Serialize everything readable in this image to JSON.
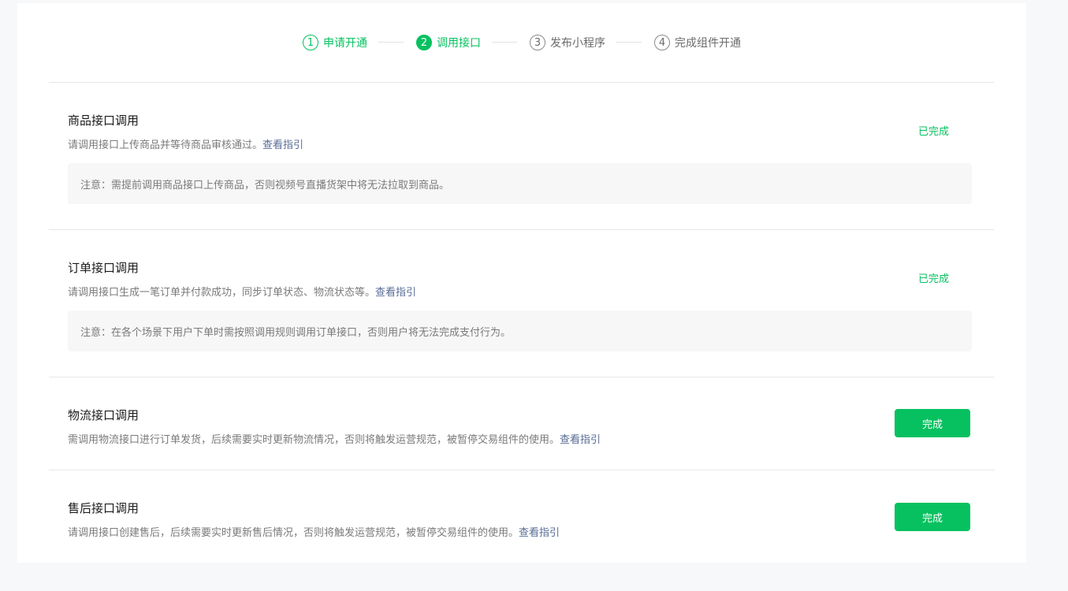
{
  "steps": [
    {
      "num": "1",
      "label": "申请开通",
      "state": "done"
    },
    {
      "num": "2",
      "label": "调用接口",
      "state": "active"
    },
    {
      "num": "3",
      "label": "发布小程序",
      "state": "todo"
    },
    {
      "num": "4",
      "label": "完成组件开通",
      "state": "todo"
    }
  ],
  "sections": [
    {
      "title": "商品接口调用",
      "desc": "请调用接口上传商品并等待商品审核通过。",
      "link": "查看指引",
      "notice": "注意：需提前调用商品接口上传商品，否则视频号直播货架中将无法拉取到商品。",
      "status": "已完成"
    },
    {
      "title": "订单接口调用",
      "desc": "请调用接口生成一笔订单并付款成功，同步订单状态、物流状态等。",
      "link": "查看指引",
      "notice": "注意：在各个场景下用户下单时需按照调用规则调用订单接口，否则用户将无法完成支付行为。",
      "status": "已完成"
    },
    {
      "title": "物流接口调用",
      "desc": "需调用物流接口进行订单发货，后续需要实时更新物流情况，否则将触发运营规范，被暂停交易组件的使用。",
      "link": "查看指引",
      "button": "完成"
    },
    {
      "title": "售后接口调用",
      "desc": "请调用接口创建售后，后续需要实时更新售后情况，否则将触发运营规范，被暂停交易组件的使用。",
      "link": "查看指引",
      "button": "完成"
    }
  ],
  "colors": {
    "accent": "#07c160",
    "link": "#576b95",
    "muted": "#7a7a7a",
    "page_bg": "#f7f8fa"
  }
}
